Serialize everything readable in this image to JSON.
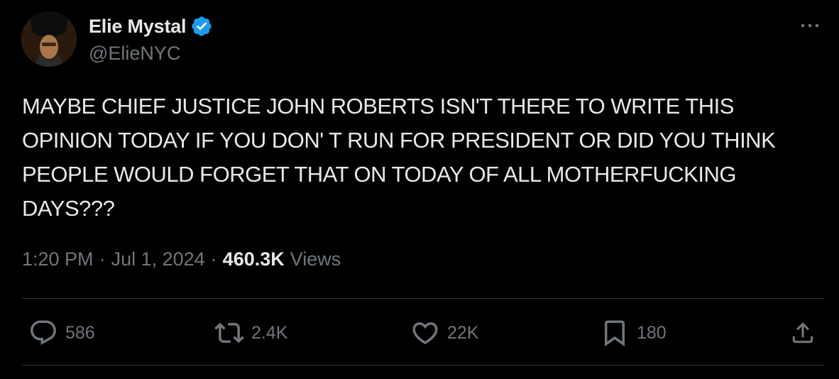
{
  "author": {
    "display_name": "Elie Mystal",
    "handle": "@ElieNYC",
    "verified": true,
    "verified_color": "#1d9bf0"
  },
  "tweet": {
    "text": "MAYBE CHIEF JUSTICE JOHN ROBERTS ISN'T THERE TO WRITE THIS OPINION TODAY IF YOU DON' T RUN FOR PRESIDENT OR DID YOU THINK PEOPLE WOULD FORGET THAT ON TODAY OF ALL MOTHERFUCKING DAYS???",
    "time": "1:20 PM",
    "date": "Jul 1, 2024",
    "separator": "·",
    "views_count": "460.3K",
    "views_label": "Views"
  },
  "actions": {
    "replies": "586",
    "reposts": "2.4K",
    "likes": "22K",
    "bookmarks": "180"
  },
  "icons": {
    "more": "more-horizontal-icon",
    "reply": "reply-icon",
    "repost": "repost-icon",
    "like": "heart-icon",
    "bookmark": "bookmark-icon",
    "share": "share-icon"
  },
  "colors": {
    "background": "#000000",
    "text_primary": "#e7e9ea",
    "text_secondary": "#71767b",
    "divider": "#2f3336"
  }
}
